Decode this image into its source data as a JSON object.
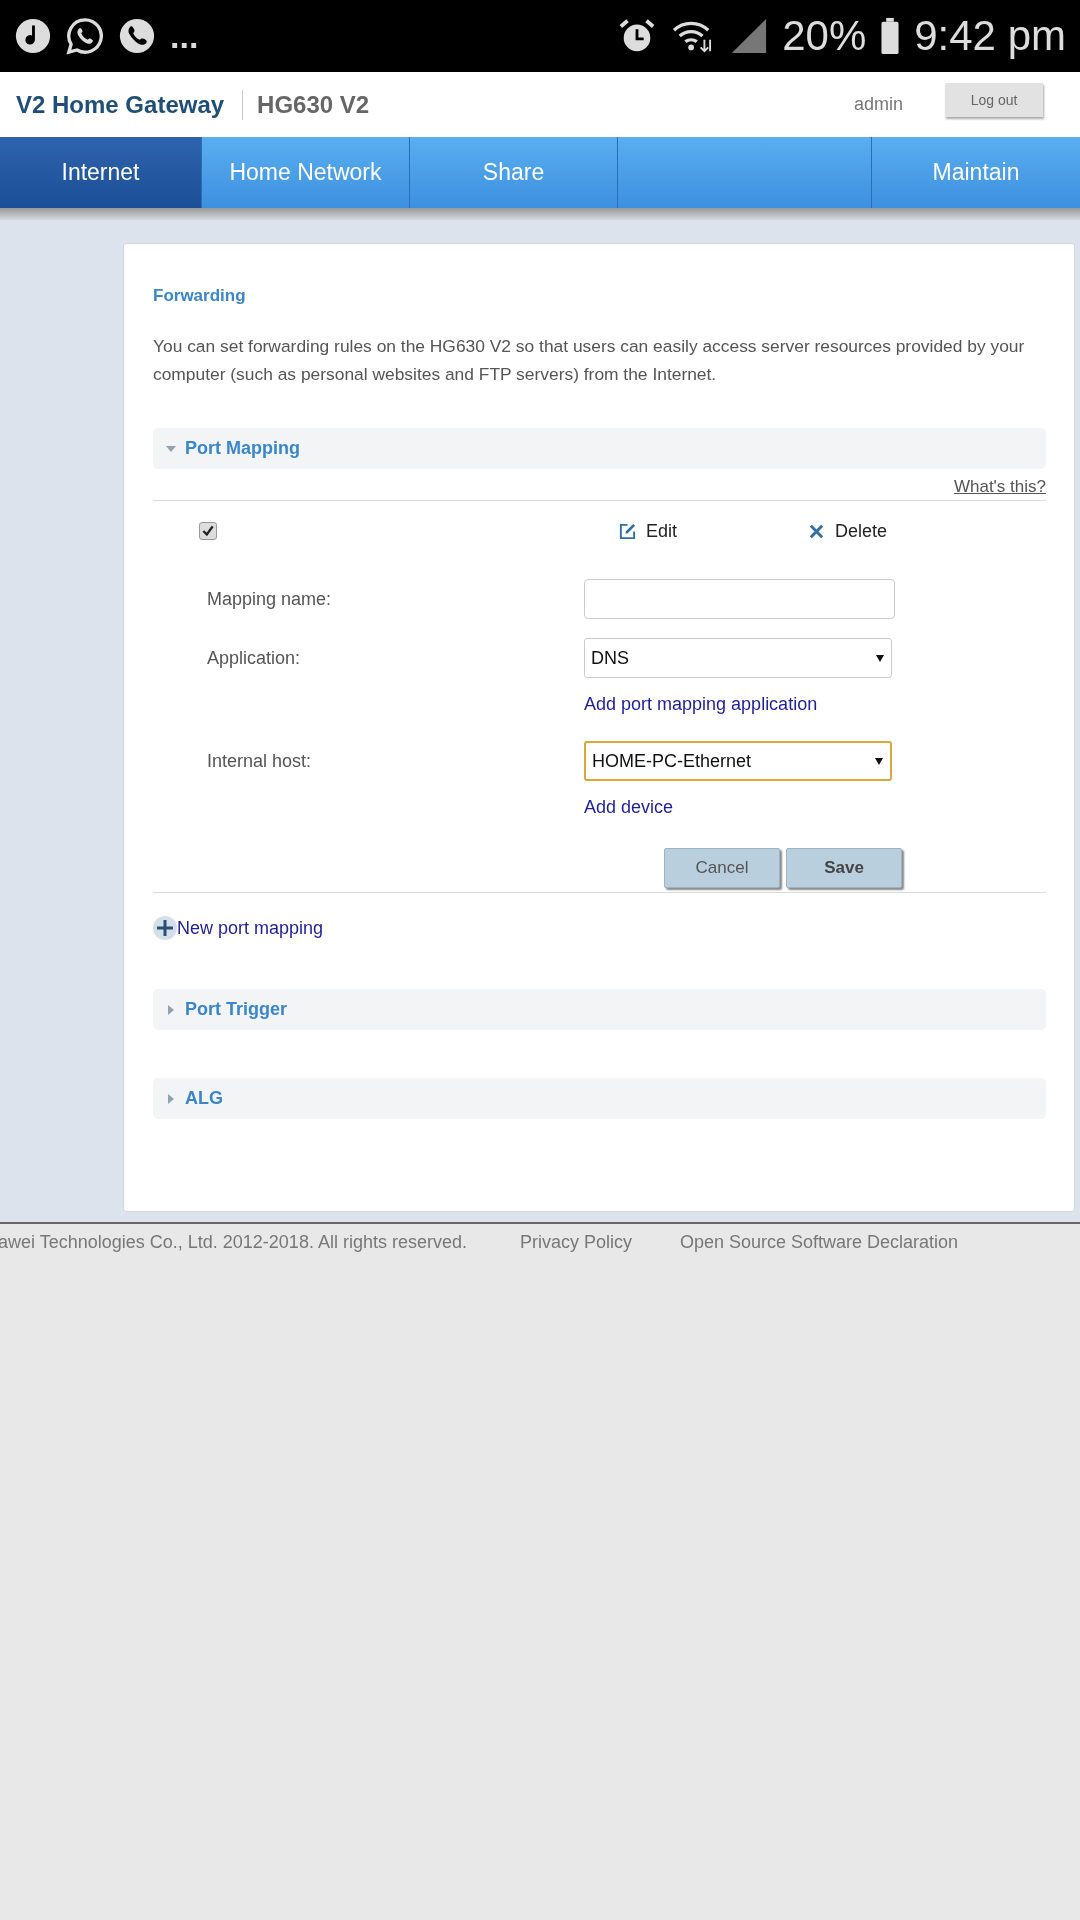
{
  "status_bar": {
    "more": "...",
    "battery": "20%",
    "time": "9:42 pm"
  },
  "header": {
    "product": "V2 Home Gateway",
    "model": "HG630 V2",
    "user": "admin",
    "logout": "Log out"
  },
  "tabs": [
    {
      "label": "Internet",
      "selected": true
    },
    {
      "label": "Home Network",
      "selected": false
    },
    {
      "label": "Share",
      "selected": false
    },
    {
      "selected": false
    },
    {
      "label": "Maintain",
      "selected": false
    }
  ],
  "page": {
    "title": "Forwarding",
    "description": "You can set forwarding rules on the HG630 V2 so that users can easily access server resources provided by your computer (such as personal websites and FTP servers) from the Internet."
  },
  "sections": [
    {
      "title": "Port Mapping",
      "expanded": true
    },
    {
      "title": "Port Trigger",
      "expanded": false
    },
    {
      "title": "ALG",
      "expanded": false
    }
  ],
  "port_mapping": {
    "help": "What's this?",
    "select_all": {
      "checked": true
    },
    "edit": "Edit",
    "delete": "Delete",
    "fields": [
      {
        "kind": "input",
        "label": "Mapping name:",
        "focused": false
      },
      {
        "kind": "select",
        "label": "Application:",
        "value": "DNS",
        "focused": false,
        "link": "Add port mapping application"
      },
      {
        "kind": "select",
        "label": "Internal host:",
        "value": "HOME-PC-Ethernet",
        "focused": true,
        "link": "Add device"
      }
    ],
    "cancel": "Cancel",
    "save": "Save",
    "new": "New port mapping"
  },
  "footer": {
    "copyright": "awei Technologies Co., Ltd. 2012-2018. All rights reserved.",
    "links": [
      "Privacy Policy",
      "Open Source Software Declaration"
    ]
  }
}
